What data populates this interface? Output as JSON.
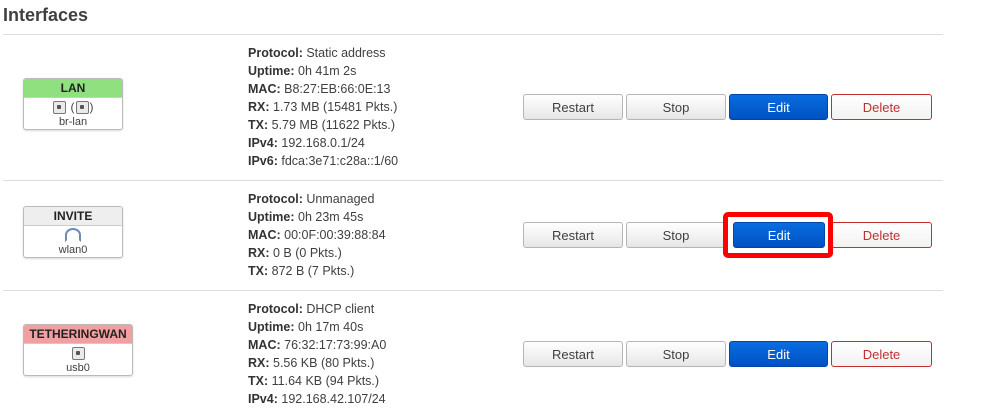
{
  "section": {
    "title": "Interfaces"
  },
  "buttons": {
    "restart": "Restart",
    "stop": "Stop",
    "edit": "Edit",
    "delete": "Delete"
  },
  "colors": {
    "lan_badge": "#90e080",
    "tethering_badge": "#f0a0a0",
    "invite_badge": "#eeeeee",
    "primary": "#0055cc",
    "highlight": "#ff0000"
  },
  "interfaces": [
    {
      "name": "LAN",
      "device": "br-lan",
      "icons": [
        "ethernet-port-icon",
        "bridge-port-icon"
      ],
      "info": [
        {
          "key": "Protocol:",
          "value": " Static address"
        },
        {
          "key": "Uptime:",
          "value": " 0h 41m 2s"
        },
        {
          "key": "MAC:",
          "value": " B8:27:EB:66:0E:13"
        },
        {
          "key": "RX:",
          "value": " 1.73 MB (15481 Pkts.)"
        },
        {
          "key": "TX:",
          "value": " 5.79 MB (11622 Pkts.)"
        },
        {
          "key": "IPv4:",
          "value": " 192.168.0.1/24"
        },
        {
          "key": "IPv6:",
          "value": " fdca:3e71:c28a::1/60"
        }
      ]
    },
    {
      "name": "INVITE",
      "device": "wlan0",
      "icons": [
        "wifi-icon"
      ],
      "info": [
        {
          "key": "Protocol:",
          "value": " Unmanaged"
        },
        {
          "key": "Uptime:",
          "value": " 0h 23m 45s"
        },
        {
          "key": "MAC:",
          "value": " 00:0F:00:39:88:84"
        },
        {
          "key": "RX:",
          "value": " 0 B (0 Pkts.)"
        },
        {
          "key": "TX:",
          "value": " 872 B (7 Pkts.)"
        }
      ]
    },
    {
      "name": "TETHERINGWAN",
      "device": "usb0",
      "icons": [
        "ethernet-port-icon"
      ],
      "info": [
        {
          "key": "Protocol:",
          "value": " DHCP client"
        },
        {
          "key": "Uptime:",
          "value": " 0h 17m 40s"
        },
        {
          "key": "MAC:",
          "value": " 76:32:17:73:99:A0"
        },
        {
          "key": "RX:",
          "value": " 5.56 KB (80 Pkts.)"
        },
        {
          "key": "TX:",
          "value": " 11.64 KB (94 Pkts.)"
        },
        {
          "key": "IPv4:",
          "value": " 192.168.42.107/24"
        }
      ]
    }
  ]
}
